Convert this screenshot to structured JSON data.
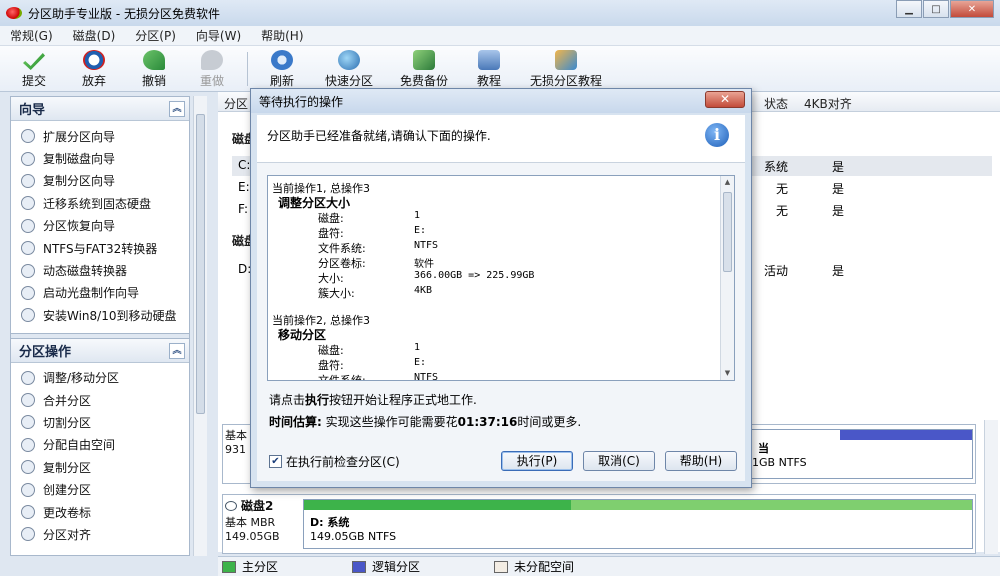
{
  "window": {
    "title": "分区助手专业版 - 无损分区免费软件",
    "min": "▁",
    "max": "□",
    "close": "✕"
  },
  "menu": [
    "常规(G)",
    "磁盘(D)",
    "分区(P)",
    "向导(W)",
    "帮助(H)"
  ],
  "toolbar": {
    "commit": "提交",
    "discard": "放弃",
    "undo": "撤销",
    "redo": "重做",
    "refresh": "刷新",
    "quick_partition": "快速分区",
    "free_backup": "免费备份",
    "tutorial": "教程",
    "lossless_tutorial": "无损分区教程"
  },
  "sidebar": {
    "wizard_title": "向导",
    "wizard_items": [
      "扩展分区向导",
      "复制磁盘向导",
      "复制分区向导",
      "迁移系统到固态硬盘",
      "分区恢复向导",
      "NTFS与FAT32转换器",
      "动态磁盘转换器",
      "启动光盘制作向导",
      "安装Win8/10到移动硬盘"
    ],
    "ops_title": "分区操作",
    "ops_items": [
      "调整/移动分区",
      "合并分区",
      "切割分区",
      "分配自由空间",
      "复制分区",
      "创建分区",
      "更改卷标",
      "分区对齐"
    ],
    "collapse": "︽"
  },
  "main": {
    "columns": {
      "partition": "分区",
      "status": "状态",
      "align": "4KB对齐"
    },
    "disk1_label": "磁盘",
    "disk2_label": "磁盘",
    "rows": [
      {
        "part": "C:",
        "status": "系统",
        "align": "是"
      },
      {
        "part": "E:",
        "status": "无",
        "align": "是"
      },
      {
        "part": "F:",
        "status": "无",
        "align": "是"
      },
      {
        "part": "D:",
        "status": "活动",
        "align": "是"
      }
    ],
    "disk_panel1": {
      "name": "基本",
      "size": "931",
      "tail_size": "1GB NTFS",
      "tail_label": "当"
    },
    "disk_panel2": {
      "name": "磁盘2",
      "type": "基本 MBR",
      "size": "149.05GB",
      "part_label": "D: 系统",
      "part_size": "149.05GB NTFS"
    }
  },
  "legend": {
    "primary": "主分区",
    "logical": "逻辑分区",
    "unallocated": "未分配空间"
  },
  "dialog": {
    "title": "等待执行的操作",
    "close": "✕",
    "message": "分区助手已经准备就绪,请确认下面的操作.",
    "info_icon": "i",
    "op1": {
      "header": "当前操作1, 总操作3",
      "name": "调整分区大小",
      "fields": [
        {
          "k": "磁盘:",
          "v": "1"
        },
        {
          "k": "盘符:",
          "v": "E:"
        },
        {
          "k": "文件系统:",
          "v": "NTFS"
        },
        {
          "k": "分区卷标:",
          "v": "软件"
        },
        {
          "k": "大小:",
          "v": "366.00GB => 225.99GB"
        },
        {
          "k": "簇大小:",
          "v": "4KB"
        }
      ]
    },
    "op2": {
      "header": "当前操作2, 总操作3",
      "name": "移动分区",
      "fields": [
        {
          "k": "磁盘:",
          "v": "1"
        },
        {
          "k": "盘符:",
          "v": "E:"
        },
        {
          "k": "文件系统:",
          "v": "NTFS"
        }
      ]
    },
    "scroll_up": "▲",
    "scroll_down": "▼",
    "hint_pre": "请点击",
    "hint_bold": "执行",
    "hint_post": "按钮开始让程序正式地工作.",
    "est_label": "时间估算:",
    "est_pre": " 实现这些操作可能需要花",
    "est_time": "01:37:16",
    "est_post": "时间或更多.",
    "check_label": "在执行前检查分区(C)",
    "check_mark": "✔",
    "btn_execute": "执行(P)",
    "btn_cancel": "取消(C)",
    "btn_help": "帮助(H)"
  },
  "colors": {
    "primary": "#3db34a",
    "logical": "#4a57c8",
    "unallocated": "#f3ede4",
    "accent": "#1d5fb8"
  }
}
